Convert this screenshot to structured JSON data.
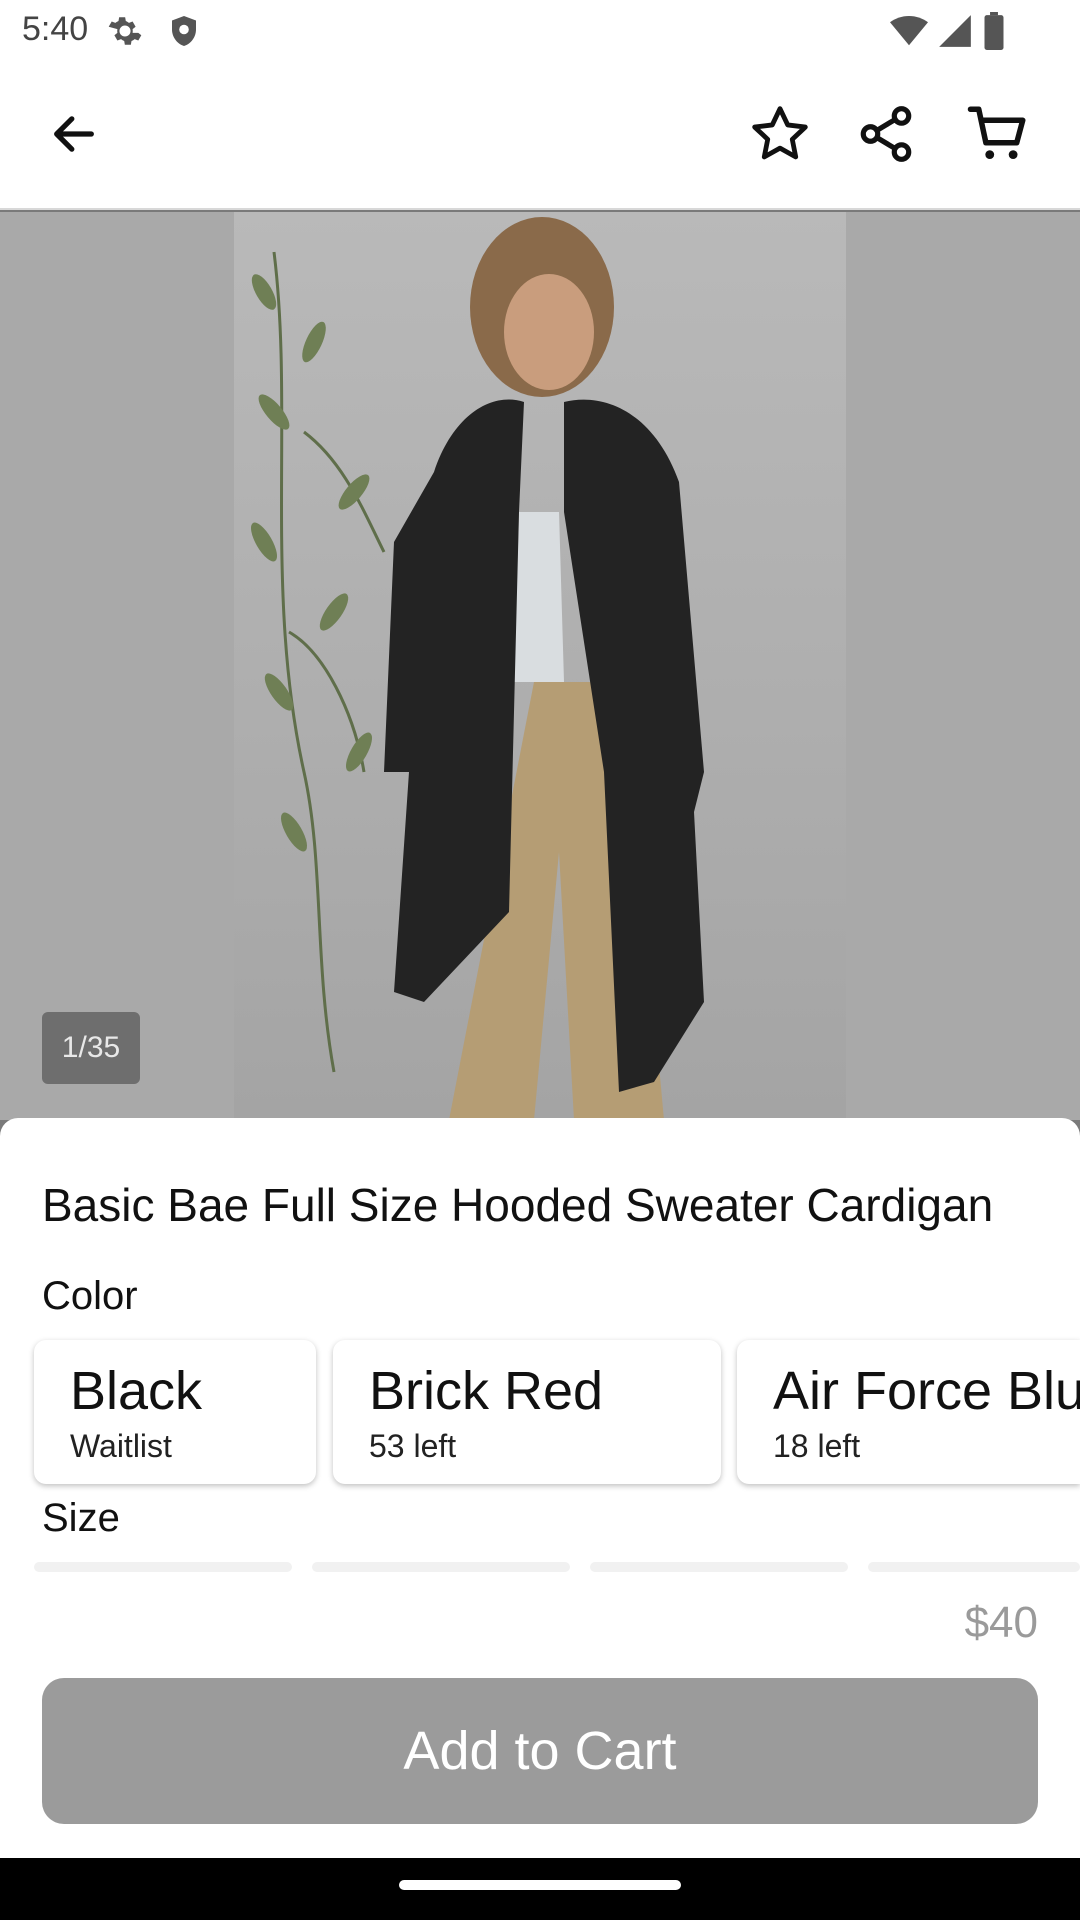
{
  "status": {
    "time": "5:40",
    "icons": [
      "settings-icon",
      "shield-icon",
      "wifi-icon",
      "signal-icon",
      "battery-icon"
    ]
  },
  "app_bar": {
    "back_icon": "arrow-left-icon",
    "favorite_icon": "star-outline-icon",
    "share_icon": "share-icon",
    "cart_icon": "cart-icon"
  },
  "gallery": {
    "counter": "1/35"
  },
  "product": {
    "title": "Basic Bae Full Size Hooded Sweater Cardigan",
    "color_label": "Color",
    "colors": [
      {
        "name": "Black",
        "stock": "Waitlist"
      },
      {
        "name": "Brick Red",
        "stock": "53 left"
      },
      {
        "name": "Air Force Blu",
        "stock": "18 left"
      }
    ],
    "size_label": "Size"
  },
  "checkout": {
    "price": "$40",
    "add_to_cart": "Add to Cart"
  },
  "colors": {
    "overlay_gray": "#7a7a7a",
    "button_gray": "#9b9b9b"
  }
}
